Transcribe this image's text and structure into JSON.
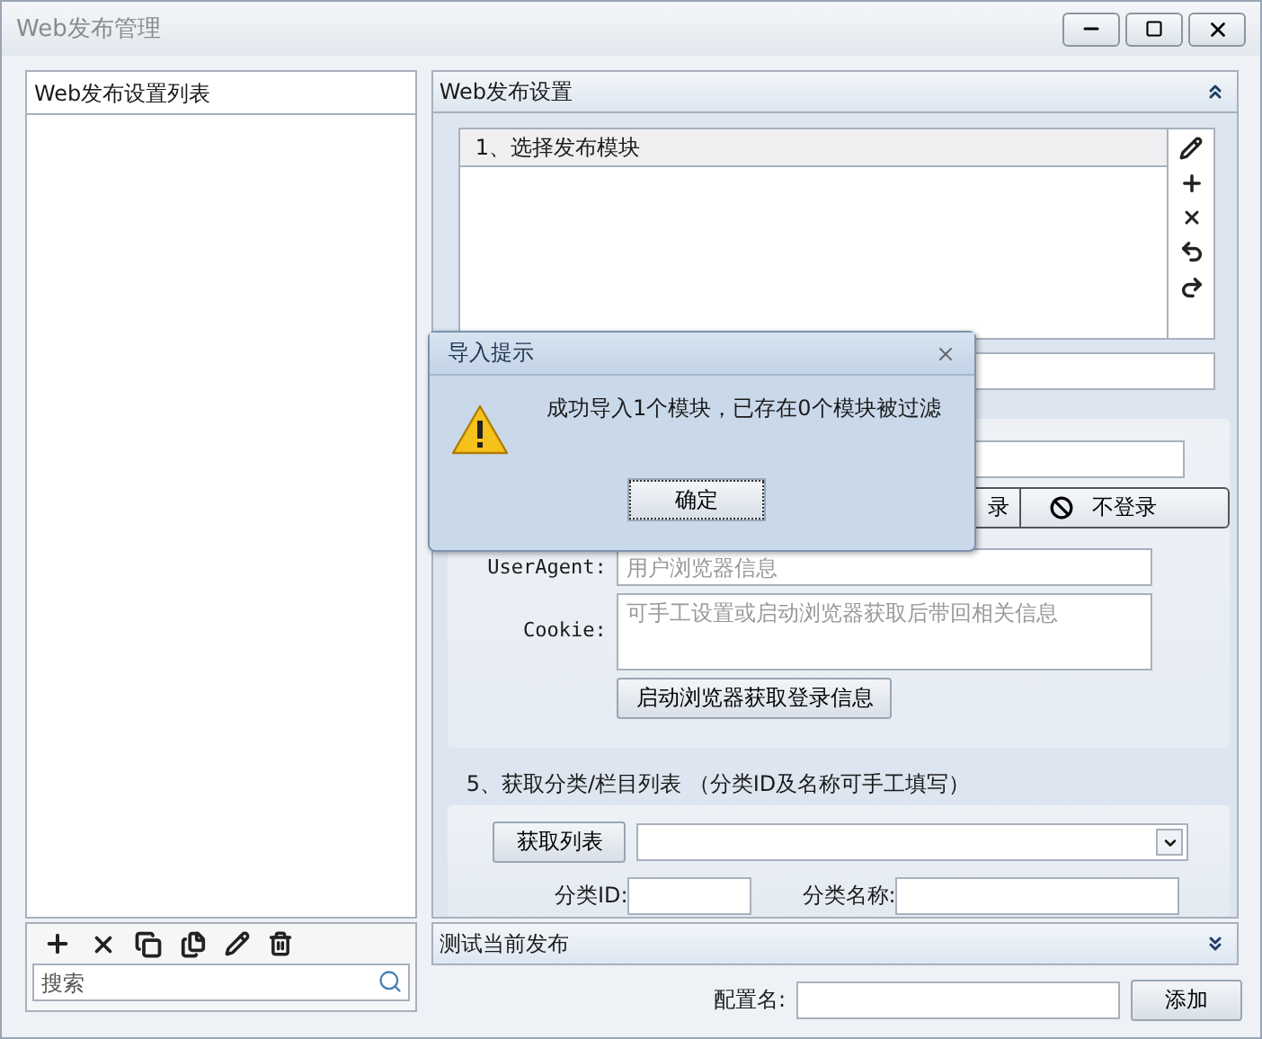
{
  "window": {
    "title": "Web发布管理"
  },
  "left_panel": {
    "title": "Web发布设置列表",
    "search": {
      "placeholder": "搜索"
    }
  },
  "settings_panel": {
    "title": "Web发布设置",
    "expanded": true,
    "module_box": {
      "title": "1、选择发布模块"
    },
    "login_options": [
      {
        "label": "录"
      },
      {
        "label": "不登录"
      }
    ],
    "user_agent": {
      "label": "UserAgent:",
      "placeholder": "用户浏览器信息"
    },
    "cookie": {
      "label": "Cookie:",
      "placeholder": "可手工设置或启动浏览器获取后带回相关信息"
    },
    "launch_button": "启动浏览器获取登录信息",
    "category": {
      "title": "5、获取分类/栏目列表 （分类ID及名称可手工填写）",
      "fetch_button": "获取列表",
      "id_label": "分类ID:",
      "name_label": "分类名称:"
    }
  },
  "test_panel": {
    "title": "测试当前发布",
    "expanded": false
  },
  "footer": {
    "config_label": "配置名:",
    "add_button": "添加"
  },
  "dialog": {
    "title": "导入提示",
    "message": "成功导入1个模块，已存在0个模块被过滤",
    "ok_button": "确定"
  }
}
